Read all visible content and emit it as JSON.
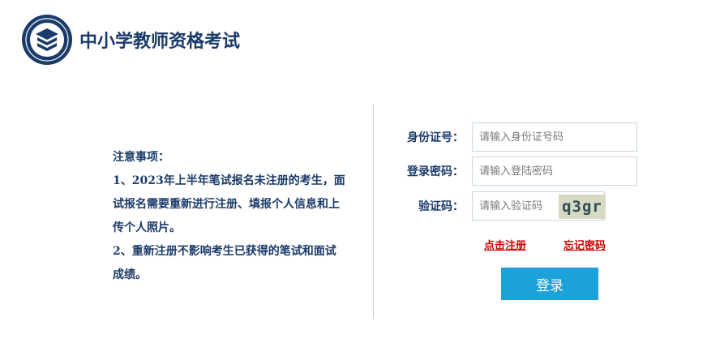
{
  "header": {
    "title": "中小学教师资格考试",
    "logo_icon": "teacher-cert-seal-icon",
    "brand_color": "#1b3b6a"
  },
  "notice": {
    "heading": "注意事项：",
    "item1_line1": "1、2023年上半年笔试报名未注册的考生，面",
    "item1_line2": "试报名需要重新进行注册、填报个人信息和上",
    "item1_line3": "传个人照片。",
    "item2_line1": "2、重新注册不影响考生已获得的笔试和面试",
    "item2_line2": "成绩。"
  },
  "form": {
    "id_label": "身份证号：",
    "id_placeholder": "请输入身份证号码",
    "password_label": "登录密码：",
    "password_placeholder": "请输入登陆密码",
    "captcha_label": "验证码：",
    "captcha_placeholder": "请输入验证码",
    "captcha_text": "q3gr",
    "register_link": "点击注册",
    "forgot_link": "忘记密码",
    "login_button": "登录",
    "accent_color": "#1ca1d9",
    "link_color": "#cc0000"
  }
}
